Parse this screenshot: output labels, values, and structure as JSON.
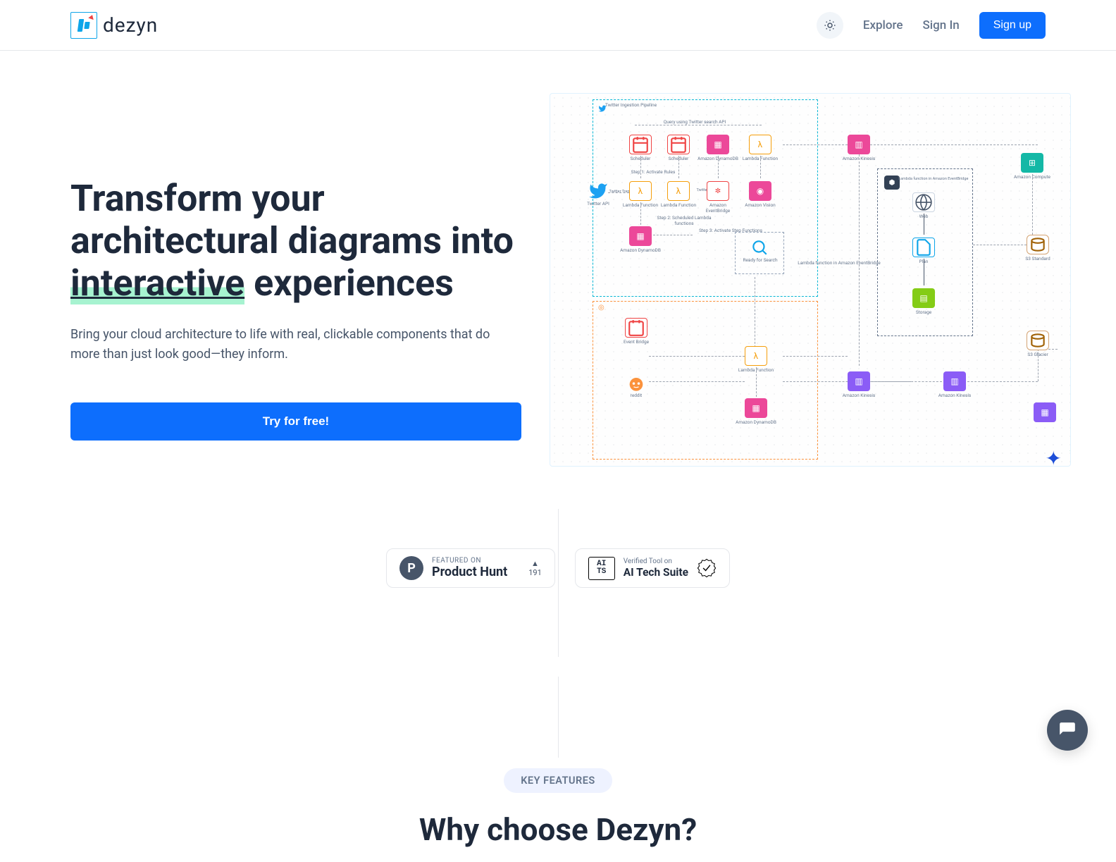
{
  "brand": {
    "name": "dezyn"
  },
  "nav": {
    "explore": "Explore",
    "signin": "Sign In",
    "signup": "Sign up"
  },
  "hero": {
    "title_pre": "Transform your architectural diagrams into ",
    "title_highlight": "interactive",
    "title_post": " experiences",
    "subtitle": "Bring your cloud architecture to life with real, clickable components that do more than just look good—they inform.",
    "cta": "Try for free!"
  },
  "badges": {
    "product_hunt": {
      "featured_on": "FEATURED ON",
      "name": "Product Hunt",
      "votes": "191"
    },
    "aits": {
      "mark": "AI\nTS",
      "verified_on": "Verified Tool on",
      "name": "AI Tech Suite"
    }
  },
  "features": {
    "pill": "KEY FEATURES",
    "heading": "Why choose Dezyn?"
  },
  "diagram": {
    "twitter_label": "Twitter Ingestion Pipeline",
    "query_api": "Query using Twitter search API",
    "step1": "Step 1: Activate Rules",
    "step2": "Step 2: Scheduled Lambda functions",
    "step3": "Step 3: Activate Step Functions",
    "twitter_trends": "Twitter Trends",
    "lambda_eventbridge": "Lambda function in Amazon EventBridge",
    "nodes": {
      "scheduler": "Scheduler",
      "scheduler2": "Scheduler",
      "dynamo": "Amazon DynamoDB",
      "lambda": "Lambda Function",
      "twitter_api": "Twitter API",
      "lambda_fn": "Lambda Function",
      "lambda_fn2": "Lambda Function",
      "eventbridge": "Amazon EventBridge",
      "amazon_vision": "Amazon Vision",
      "amazon_dynamo2": "Amazon DynamoDB",
      "ready_search": "Ready for Search",
      "event_bridge2": "Event Bridge",
      "lambda_fn3": "Lambda Function",
      "reddit": "reddit",
      "amazon_kinesis": "Amazon Kinesis",
      "amazon_kinesis2": "Amazon Kinesis",
      "amazon_compute": "Amazon Compute",
      "s3_standard": "S3 Standard",
      "s3_glacier": "S3 Glacier",
      "web": "Web",
      "plan": "Plan",
      "storage": "Storage",
      "amazon_dynamo3": "Amazon DynamoDB"
    }
  }
}
